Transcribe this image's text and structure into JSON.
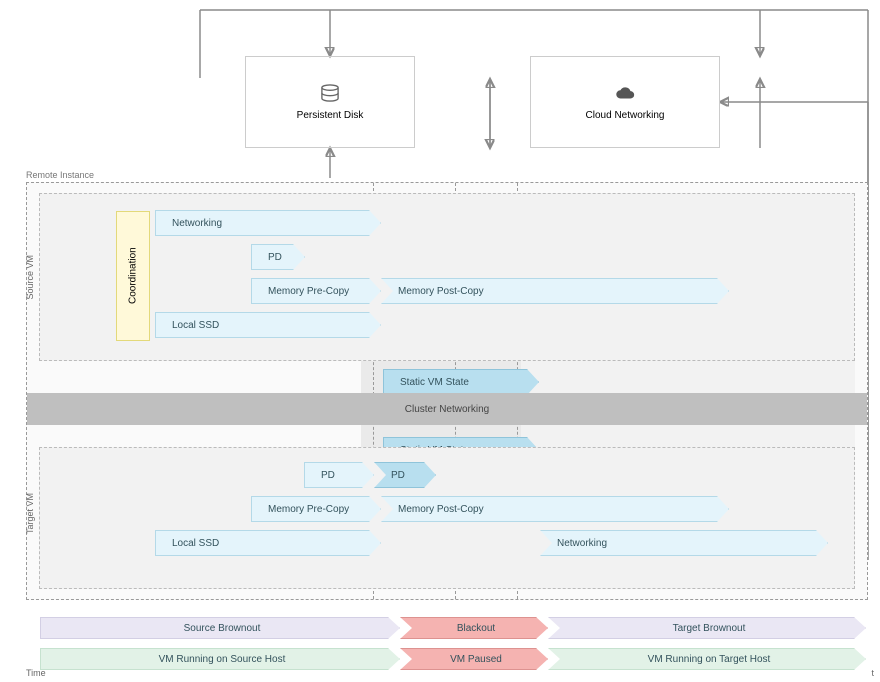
{
  "top": {
    "persistent_disk_label": "Persistent Disk",
    "cloud_networking_label": "Cloud Networking"
  },
  "labels": {
    "remote_instance": "Remote Instance",
    "source_vm": "Source VM",
    "target_vm": "Target VM",
    "time": "Time",
    "time_right": "t"
  },
  "source_vm": {
    "coordination": "Coordination",
    "networking": "Networking",
    "pd": "PD",
    "memory_pre": "Memory Pre-Copy",
    "memory_post": "Memory Post-Copy",
    "local_ssd": "Local SSD",
    "static_vm_state": "Static VM State"
  },
  "cluster": {
    "label": "Cluster Networking"
  },
  "target_vm": {
    "static_vm_state": "Static VM State",
    "pd1": "PD",
    "pd2": "PD",
    "memory_pre": "Memory Pre-Copy",
    "memory_post": "Memory Post-Copy",
    "local_ssd": "Local SSD",
    "networking": "Networking"
  },
  "phases": {
    "source_brownout": "Source Brownout",
    "blackout": "Blackout",
    "target_brownout": "Target Brownout",
    "vm_running_source": "VM Running on Source Host",
    "vm_paused": "VM Paused",
    "vm_running_target": "VM Running on Target Host"
  },
  "colors": {
    "blue_light": "#e4f4fb",
    "blue_dark": "#b8dfef",
    "green": "#e2f2e7",
    "red": "#f5b3b1",
    "lilac": "#eae7f4",
    "grey_band": "#bfbfbf"
  }
}
